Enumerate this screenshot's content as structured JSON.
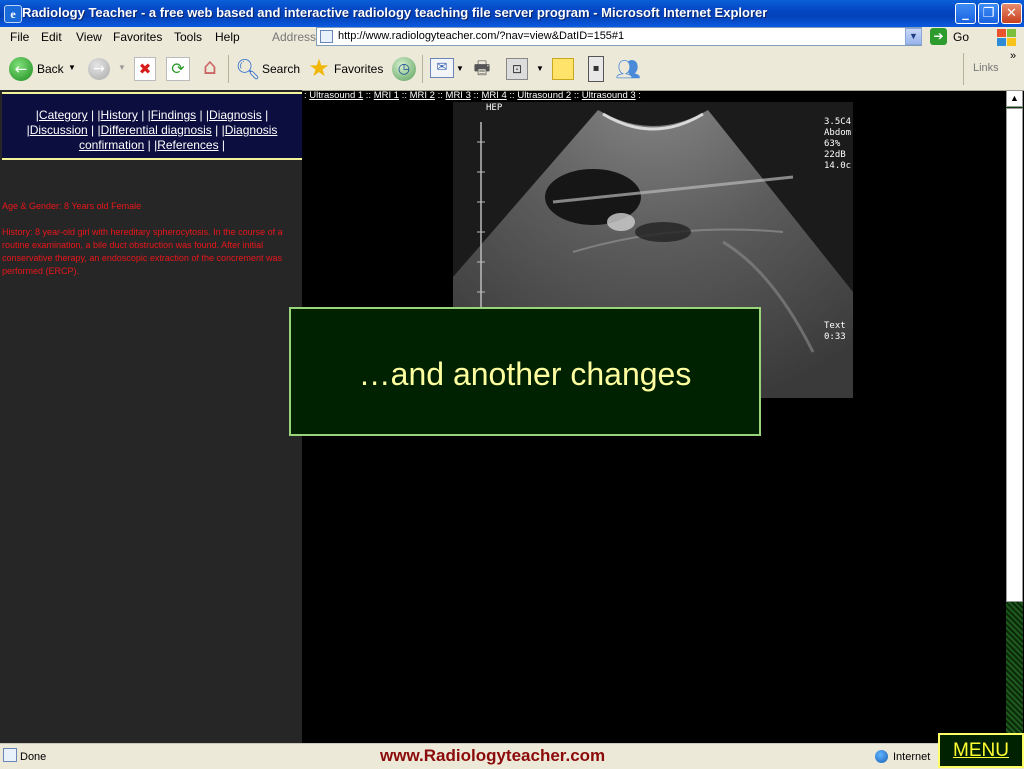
{
  "window": {
    "title": "Radiology Teacher - a free web based and interactive radiology teaching file server program - Microsoft Internet Explorer",
    "minimize_glyph": "_",
    "maximize_glyph": "❐",
    "close_glyph": "✕"
  },
  "menubar": {
    "items": [
      "File",
      "Edit",
      "View",
      "Favorites",
      "Tools",
      "Help"
    ],
    "address_label": "Address",
    "address_value": "http://www.radiologyteacher.com/?nav=view&DatID=155#1",
    "go_label": "Go"
  },
  "toolbar": {
    "back_label": "Back",
    "search_label": "Search",
    "favorites_label": "Favorites",
    "links_label": "Links",
    "chevron": "»"
  },
  "nav": {
    "links": [
      "Category",
      "History",
      "Findings",
      "Diagnosis",
      "Discussion",
      "Differential diagnosis",
      "Diagnosis confirmation",
      "References"
    ],
    "sep": " |"
  },
  "case": {
    "age_gender": "Age & Gender: 8 Years old Female",
    "history": "History: 8 year-old girl with hereditary spherocytosis. In the course of a routine examination, a bile duct obstruction was found. After initial conservative therapy, an endoscopic extraction of the concrement was performed (ERCP)."
  },
  "series": {
    "items": [
      "Ultrasound 1",
      "MRI 1",
      "MRI 2",
      "MRI 3",
      "MRI 4",
      "Ultrasound 2",
      "Ultrasound 3"
    ],
    "separator": "::",
    "lead": ":",
    "trail": ":"
  },
  "ultrasound": {
    "label": "HEP",
    "params": "3.5C4\nAbdom\n63%\n22dB\n14.0c",
    "text2": "Text\n0:33"
  },
  "overlay": {
    "text": "…and another changes"
  },
  "status": {
    "done": "Done",
    "footer_url": "www.Radiologyteacher.com",
    "zone": "Internet",
    "menu_button": "MENU"
  },
  "colors": {
    "nav_bg": "#0b0e3f",
    "nav_border": "#f3f39a",
    "case_text": "#e8161b",
    "overlay_bg": "#002200",
    "overlay_text": "#ffffa0",
    "footer_url": "#8b0a0a"
  },
  "icons": {
    "back": "back-arrow-icon",
    "forward": "forward-arrow-icon",
    "stop": "stop-icon",
    "refresh": "refresh-icon",
    "home": "home-icon",
    "search": "search-magnifier-icon",
    "favorites": "favorites-star-icon",
    "history": "history-icon",
    "mail": "mail-icon",
    "print": "print-icon",
    "edit": "edit-icon",
    "discuss": "discuss-icon",
    "research": "research-icon",
    "messenger": "messenger-icon"
  }
}
